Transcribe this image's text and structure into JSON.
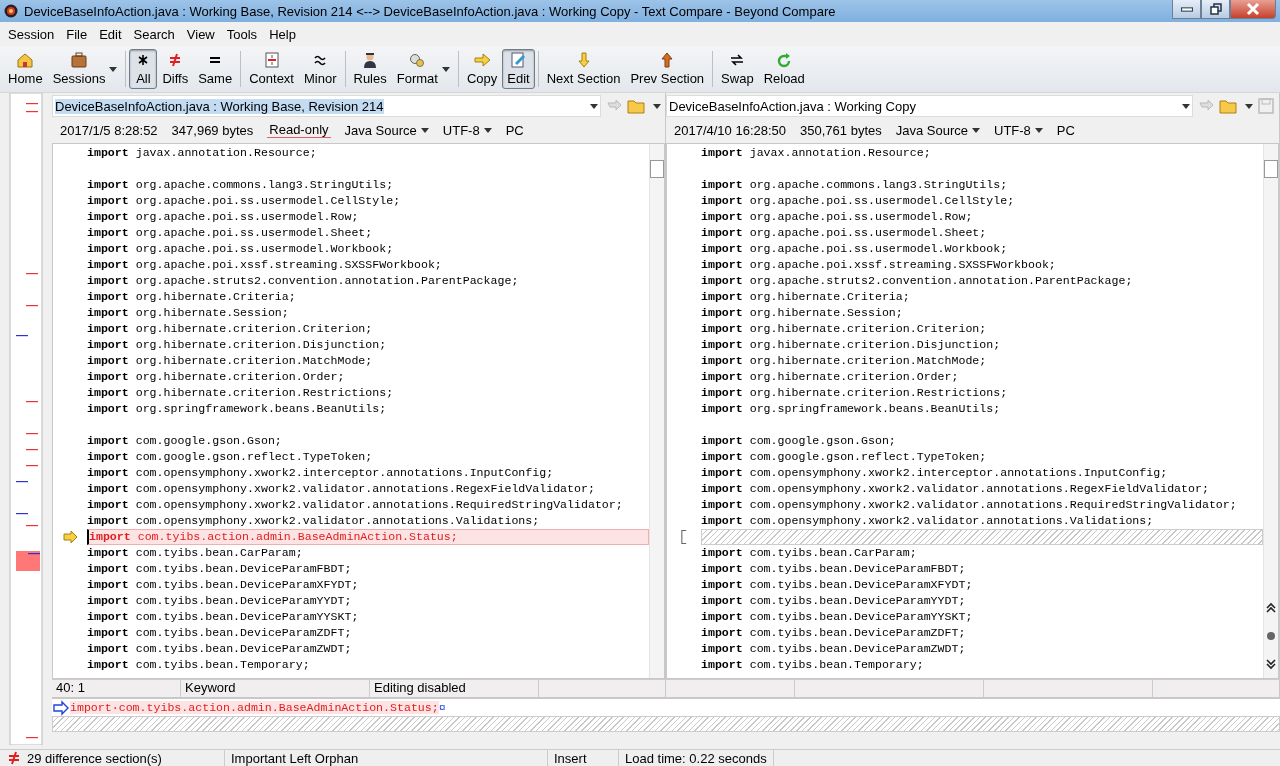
{
  "window": {
    "title": "DeviceBaseInfoAction.java : Working Base, Revision 214 <--> DeviceBaseInfoAction.java : Working Copy - Text Compare - Beyond Compare"
  },
  "menu": [
    "Session",
    "File",
    "Edit",
    "Search",
    "View",
    "Tools",
    "Help"
  ],
  "toolbar": [
    {
      "buttons": [
        {
          "label": "Home",
          "selected": false,
          "dropdown": false
        },
        {
          "label": "Sessions",
          "selected": false,
          "dropdown": true
        }
      ]
    },
    {
      "buttons": [
        {
          "label": "All",
          "selected": true,
          "dropdown": false
        },
        {
          "label": "Diffs",
          "selected": false,
          "dropdown": false
        },
        {
          "label": "Same",
          "selected": false,
          "dropdown": false
        }
      ]
    },
    {
      "buttons": [
        {
          "label": "Context",
          "selected": false,
          "dropdown": false
        },
        {
          "label": "Minor",
          "selected": false,
          "dropdown": false
        }
      ]
    },
    {
      "buttons": [
        {
          "label": "Rules",
          "selected": false,
          "dropdown": false
        },
        {
          "label": "Format",
          "selected": false,
          "dropdown": true
        }
      ]
    },
    {
      "buttons": [
        {
          "label": "Copy",
          "selected": false,
          "dropdown": false
        },
        {
          "label": "Edit",
          "selected": true,
          "dropdown": false
        }
      ]
    },
    {
      "buttons": [
        {
          "label": "Next Section",
          "selected": false,
          "dropdown": false
        },
        {
          "label": "Prev Section",
          "selected": false,
          "dropdown": false
        }
      ]
    },
    {
      "buttons": [
        {
          "label": "Swap",
          "selected": false,
          "dropdown": false
        },
        {
          "label": "Reload",
          "selected": false,
          "dropdown": false
        }
      ]
    }
  ],
  "panes": [
    {
      "path": "DeviceBaseInfoAction.java : Working Base, Revision 214",
      "path_selected": true,
      "date": "2017/1/5 8:28:52",
      "size": "347,969 bytes",
      "readonly": "Read-only",
      "format": "Java Source",
      "encoding": "UTF-8",
      "line_ending": "PC",
      "lines": [
        {
          "kind": "same",
          "keyword": "import",
          "text": "javax.annotation.Resource;"
        },
        {
          "kind": "blank"
        },
        {
          "kind": "same",
          "keyword": "import",
          "text": "org.apache.commons.lang3.StringUtils;"
        },
        {
          "kind": "same",
          "keyword": "import",
          "text": "org.apache.poi.ss.usermodel.CellStyle;"
        },
        {
          "kind": "same",
          "keyword": "import",
          "text": "org.apache.poi.ss.usermodel.Row;"
        },
        {
          "kind": "same",
          "keyword": "import",
          "text": "org.apache.poi.ss.usermodel.Sheet;"
        },
        {
          "kind": "same",
          "keyword": "import",
          "text": "org.apache.poi.ss.usermodel.Workbook;"
        },
        {
          "kind": "same",
          "keyword": "import",
          "text": "org.apache.poi.xssf.streaming.SXSSFWorkbook;"
        },
        {
          "kind": "same",
          "keyword": "import",
          "text": "org.apache.struts2.convention.annotation.ParentPackage;"
        },
        {
          "kind": "same",
          "keyword": "import",
          "text": "org.hibernate.Criteria;"
        },
        {
          "kind": "same",
          "keyword": "import",
          "text": "org.hibernate.Session;"
        },
        {
          "kind": "same",
          "keyword": "import",
          "text": "org.hibernate.criterion.Criterion;"
        },
        {
          "kind": "same",
          "keyword": "import",
          "text": "org.hibernate.criterion.Disjunction;"
        },
        {
          "kind": "same",
          "keyword": "import",
          "text": "org.hibernate.criterion.MatchMode;"
        },
        {
          "kind": "same",
          "keyword": "import",
          "text": "org.hibernate.criterion.Order;"
        },
        {
          "kind": "same",
          "keyword": "import",
          "text": "org.hibernate.criterion.Restrictions;"
        },
        {
          "kind": "same",
          "keyword": "import",
          "text": "org.springframework.beans.BeanUtils;"
        },
        {
          "kind": "blank"
        },
        {
          "kind": "same",
          "keyword": "import",
          "text": "com.google.gson.Gson;"
        },
        {
          "kind": "same",
          "keyword": "import",
          "text": "com.google.gson.reflect.TypeToken;"
        },
        {
          "kind": "same",
          "keyword": "import",
          "text": "com.opensymphony.xwork2.interceptor.annotations.InputConfig;"
        },
        {
          "kind": "same",
          "keyword": "import",
          "text": "com.opensymphony.xwork2.validator.annotations.RegexFieldValidator;"
        },
        {
          "kind": "same",
          "keyword": "import",
          "text": "com.opensymphony.xwork2.validator.annotations.RequiredStringValidator;"
        },
        {
          "kind": "same",
          "keyword": "import",
          "text": "com.opensymphony.xwork2.validator.annotations.Validations;"
        },
        {
          "kind": "orphan",
          "keyword": "import",
          "text": "com.tyibs.action.admin.BaseAdminAction.Status;"
        },
        {
          "kind": "same",
          "keyword": "import",
          "text": "com.tyibs.bean.CarParam;"
        },
        {
          "kind": "same",
          "keyword": "import",
          "text": "com.tyibs.bean.DeviceParamFBDT;"
        },
        {
          "kind": "same",
          "keyword": "import",
          "text": "com.tyibs.bean.DeviceParamXFYDT;"
        },
        {
          "kind": "same",
          "keyword": "import",
          "text": "com.tyibs.bean.DeviceParamYYDT;"
        },
        {
          "kind": "same",
          "keyword": "import",
          "text": "com.tyibs.bean.DeviceParamYYSKT;"
        },
        {
          "kind": "same",
          "keyword": "import",
          "text": "com.tyibs.bean.DeviceParamZDFT;"
        },
        {
          "kind": "same",
          "keyword": "import",
          "text": "com.tyibs.bean.DeviceParamZWDT;"
        },
        {
          "kind": "same",
          "keyword": "import",
          "text": "com.tyibs.bean.Temporary;"
        }
      ],
      "status": [
        "40: 1",
        "Keyword",
        "Editing disabled"
      ]
    },
    {
      "path": "DeviceBaseInfoAction.java : Working Copy",
      "path_selected": false,
      "date": "2017/4/10 16:28:50",
      "size": "350,761 bytes",
      "format": "Java Source",
      "encoding": "UTF-8",
      "line_ending": "PC",
      "lines": [
        {
          "kind": "same",
          "keyword": "import",
          "text": "javax.annotation.Resource;"
        },
        {
          "kind": "blank"
        },
        {
          "kind": "same",
          "keyword": "import",
          "text": "org.apache.commons.lang3.StringUtils;"
        },
        {
          "kind": "same",
          "keyword": "import",
          "text": "org.apache.poi.ss.usermodel.CellStyle;"
        },
        {
          "kind": "same",
          "keyword": "import",
          "text": "org.apache.poi.ss.usermodel.Row;"
        },
        {
          "kind": "same",
          "keyword": "import",
          "text": "org.apache.poi.ss.usermodel.Sheet;"
        },
        {
          "kind": "same",
          "keyword": "import",
          "text": "org.apache.poi.ss.usermodel.Workbook;"
        },
        {
          "kind": "same",
          "keyword": "import",
          "text": "org.apache.poi.xssf.streaming.SXSSFWorkbook;"
        },
        {
          "kind": "same",
          "keyword": "import",
          "text": "org.apache.struts2.convention.annotation.ParentPackage;"
        },
        {
          "kind": "same",
          "keyword": "import",
          "text": "org.hibernate.Criteria;"
        },
        {
          "kind": "same",
          "keyword": "import",
          "text": "org.hibernate.Session;"
        },
        {
          "kind": "same",
          "keyword": "import",
          "text": "org.hibernate.criterion.Criterion;"
        },
        {
          "kind": "same",
          "keyword": "import",
          "text": "org.hibernate.criterion.Disjunction;"
        },
        {
          "kind": "same",
          "keyword": "import",
          "text": "org.hibernate.criterion.MatchMode;"
        },
        {
          "kind": "same",
          "keyword": "import",
          "text": "org.hibernate.criterion.Order;"
        },
        {
          "kind": "same",
          "keyword": "import",
          "text": "org.hibernate.criterion.Restrictions;"
        },
        {
          "kind": "same",
          "keyword": "import",
          "text": "org.springframework.beans.BeanUtils;"
        },
        {
          "kind": "blank"
        },
        {
          "kind": "same",
          "keyword": "import",
          "text": "com.google.gson.Gson;"
        },
        {
          "kind": "same",
          "keyword": "import",
          "text": "com.google.gson.reflect.TypeToken;"
        },
        {
          "kind": "same",
          "keyword": "import",
          "text": "com.opensymphony.xwork2.interceptor.annotations.InputConfig;"
        },
        {
          "kind": "same",
          "keyword": "import",
          "text": "com.opensymphony.xwork2.validator.annotations.RegexFieldValidator;"
        },
        {
          "kind": "same",
          "keyword": "import",
          "text": "com.opensymphony.xwork2.validator.annotations.RequiredStringValidator;"
        },
        {
          "kind": "same",
          "keyword": "import",
          "text": "com.opensymphony.xwork2.validator.annotations.Validations;"
        },
        {
          "kind": "missing"
        },
        {
          "kind": "same",
          "keyword": "import",
          "text": "com.tyibs.bean.CarParam;"
        },
        {
          "kind": "same",
          "keyword": "import",
          "text": "com.tyibs.bean.DeviceParamFBDT;"
        },
        {
          "kind": "same",
          "keyword": "import",
          "text": "com.tyibs.bean.DeviceParamXFYDT;"
        },
        {
          "kind": "same",
          "keyword": "import",
          "text": "com.tyibs.bean.DeviceParamYYDT;"
        },
        {
          "kind": "same",
          "keyword": "import",
          "text": "com.tyibs.bean.DeviceParamYYSKT;"
        },
        {
          "kind": "same",
          "keyword": "import",
          "text": "com.tyibs.bean.DeviceParamZDFT;"
        },
        {
          "kind": "same",
          "keyword": "import",
          "text": "com.tyibs.bean.DeviceParamZWDT;"
        },
        {
          "kind": "same",
          "keyword": "import",
          "text": "com.tyibs.bean.Temporary;"
        }
      ]
    }
  ],
  "line_details": {
    "text": "import·com.tyibs.action.admin.BaseAdminAction.Status;",
    "end_mark": "¤"
  },
  "status_bar": {
    "count": "29 difference section(s)",
    "section": "Important Left Orphan",
    "mode": "Insert",
    "load_time": "Load time: 0.22 seconds"
  }
}
